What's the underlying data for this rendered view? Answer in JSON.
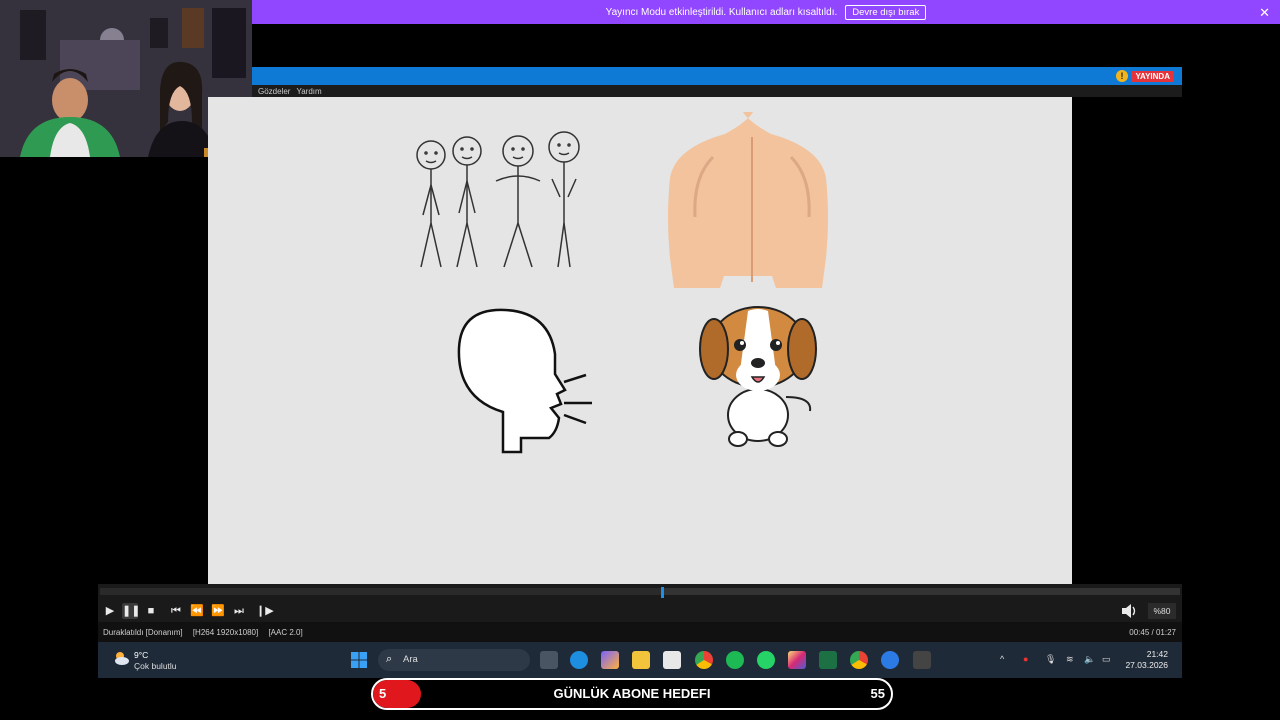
{
  "banner": {
    "text": "Yayıncı Modu etkinleştirildi. Kullanıcı adları kısaltıldı.",
    "button_label": "Devre dışı bırak"
  },
  "player": {
    "live_badge": "YAYINDA",
    "menu": [
      "Gözdeler",
      "Yardım"
    ],
    "progress": 0.52,
    "volume_label": "%80",
    "status": {
      "state": "Duraklatıldı [Donanım]",
      "video_codec": "[H264 1920x1080]",
      "audio_codec": "[AAC 2.0]",
      "time": "00:45 / 01:27"
    }
  },
  "taskbar": {
    "weather_temp": "9°C",
    "weather_desc": "Çok bulutlu",
    "search_placeholder": "Ara",
    "time": "21:42",
    "date": "27.03.2026"
  },
  "sub_goal": {
    "title": "GÜNLÜK ABONE HEDEFI",
    "current": "5",
    "target": "55",
    "progress": 0.09
  },
  "colors": {
    "banner": "#9146ff",
    "titlebar": "#0e7ad6",
    "live": "#e5333b",
    "goal_fill": "#e0181d",
    "video_bg": "#e5e5e5"
  },
  "icons": [
    "play-icon",
    "pause-icon",
    "stop-icon",
    "skip-start-icon",
    "rewind-icon",
    "fast-forward-icon",
    "skip-end-icon",
    "frame-step-icon",
    "volume-icon",
    "windows-start-icon",
    "search-icon",
    "edge-icon",
    "spotify-icon",
    "whatsapp-icon",
    "instagram-icon",
    "excel-icon",
    "chrome-icon"
  ]
}
